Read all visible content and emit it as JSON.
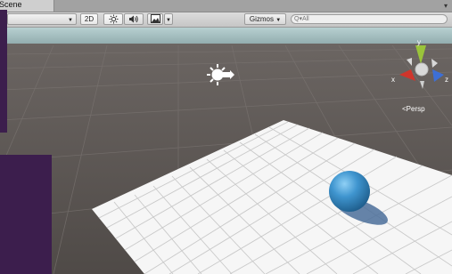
{
  "window": {
    "tab_label": "Scene",
    "menu_icon": "window-menu-icon"
  },
  "toolbar": {
    "shading_mode": "",
    "mode_2d_label": "2D",
    "lighting_icon": "sun-icon",
    "audio_icon": "speaker-icon",
    "effects_icon": "image-icon",
    "gizmos_label": "Gizmos",
    "search_placeholder": "Q▾All"
  },
  "scene": {
    "gizmo_labels": {
      "x": "x",
      "y": "y",
      "z": "z"
    },
    "projection_label": "Persp",
    "sky_top": "#9ab7b9",
    "ground_color": "#5b5552",
    "plane_color": "#f7f7f7",
    "sphere_color": "#2f86c4",
    "gizmo_colors": {
      "x": "#d0352b",
      "y": "#9ac43a",
      "z": "#3d6fd6"
    }
  },
  "overlays": {
    "color": "#3c1e4d"
  }
}
